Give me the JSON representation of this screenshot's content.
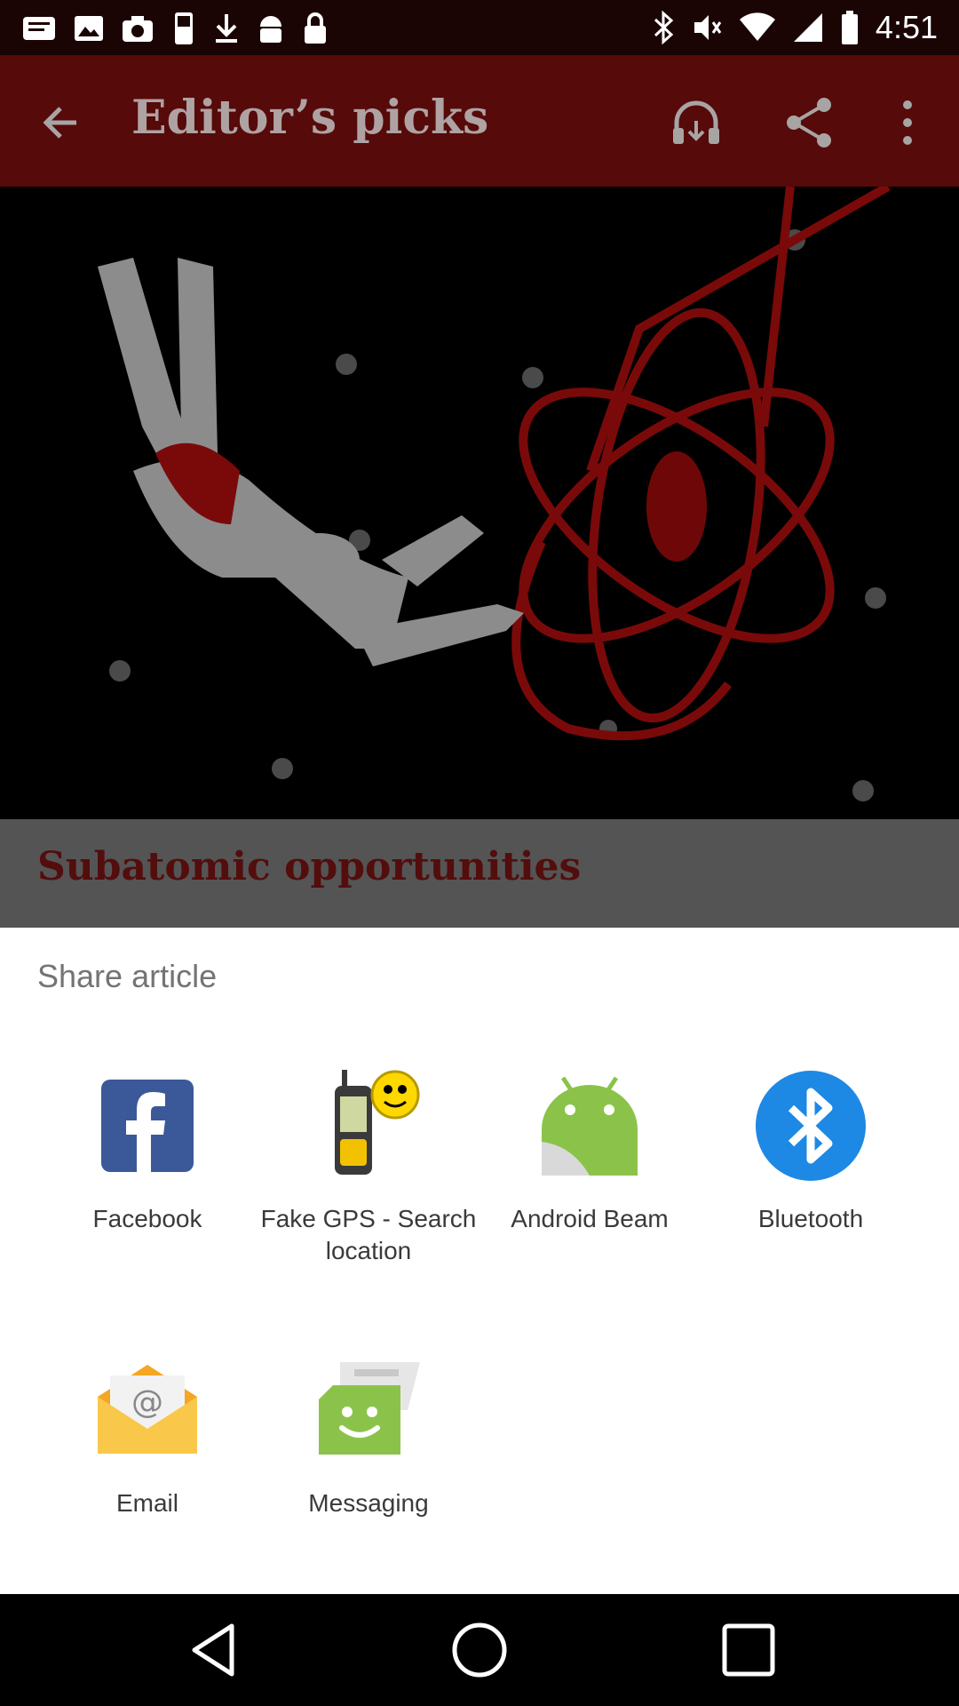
{
  "status_bar": {
    "time": "4:51",
    "icons": [
      "notification-icon",
      "image-icon",
      "camera-icon",
      "fake-gps-icon",
      "download-icon",
      "android-icon",
      "lock-icon",
      "bluetooth-icon",
      "mute-icon",
      "wifi-icon",
      "signal-icon",
      "battery-icon"
    ]
  },
  "app_bar": {
    "title": "Editor’s picks",
    "icons": [
      "back-arrow-icon",
      "headphones-download-icon",
      "share-icon",
      "more-vert-icon"
    ]
  },
  "article": {
    "title": "Subatomic opportunities"
  },
  "share_sheet": {
    "title": "Share article",
    "items": [
      {
        "label": "Facebook",
        "icon": "facebook-icon"
      },
      {
        "label": "Fake GPS - Search location",
        "icon": "fake-gps-icon"
      },
      {
        "label": "Android Beam",
        "icon": "android-beam-icon"
      },
      {
        "label": "Bluetooth",
        "icon": "bluetooth-icon"
      },
      {
        "label": "Email",
        "icon": "email-icon"
      },
      {
        "label": "Messaging",
        "icon": "messaging-icon"
      }
    ]
  },
  "nav_bar": {
    "icons": [
      "back-icon",
      "home-icon",
      "recents-icon"
    ]
  },
  "colors": {
    "app_bar": "#560a0a",
    "facebook": "#3b5998",
    "android": "#8bc34a",
    "bluetooth": "#1e88e5",
    "messaging": "#8bc34a",
    "email": "#f9b823"
  }
}
